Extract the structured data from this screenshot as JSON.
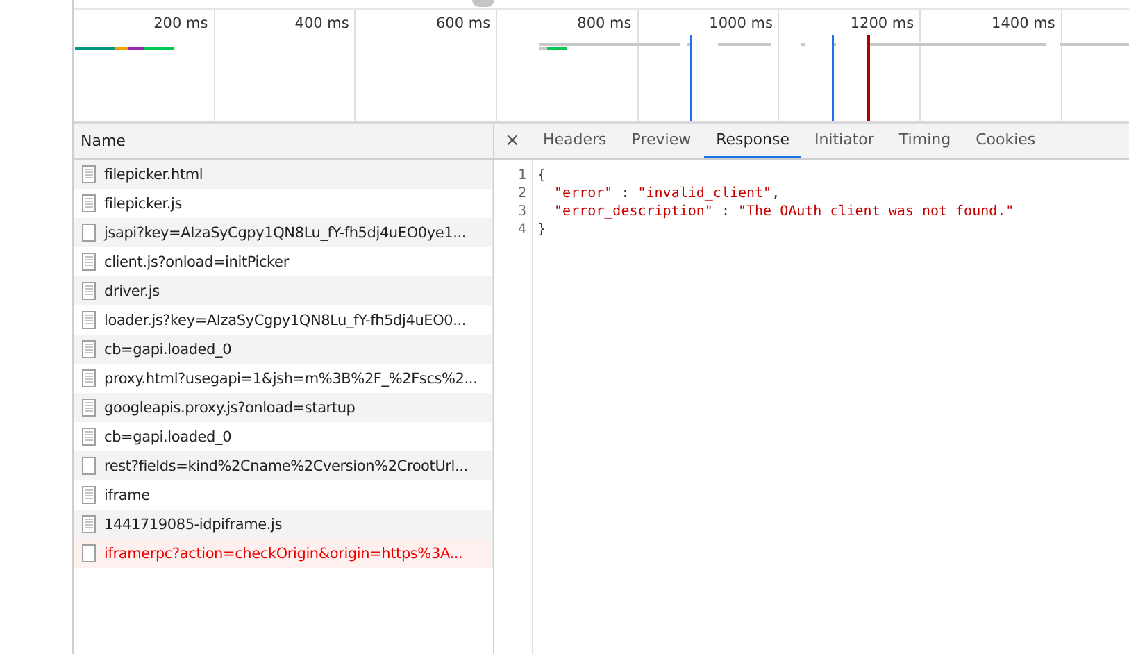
{
  "overview": {
    "ticks": [
      "200 ms",
      "400 ms",
      "600 ms",
      "800 ms",
      "1000 ms",
      "1200 ms",
      "1400 ms"
    ]
  },
  "requests": {
    "column": "Name",
    "rows": [
      {
        "name": "filepicker.html",
        "kind": "document",
        "failed": false
      },
      {
        "name": "filepicker.js",
        "kind": "document",
        "failed": false
      },
      {
        "name": "jsapi?key=AIzaSyCgpy1QN8Lu_fY-fh5dj4uEO0ye1...",
        "kind": "blank",
        "failed": false
      },
      {
        "name": "client.js?onload=initPicker",
        "kind": "document",
        "failed": false
      },
      {
        "name": "driver.js",
        "kind": "document",
        "failed": false
      },
      {
        "name": "loader.js?key=AIzaSyCgpy1QN8Lu_fY-fh5dj4uEO0...",
        "kind": "document",
        "failed": false
      },
      {
        "name": "cb=gapi.loaded_0",
        "kind": "document",
        "failed": false
      },
      {
        "name": "proxy.html?usegapi=1&jsh=m%3B%2F_%2Fscs%2...",
        "kind": "document",
        "failed": false
      },
      {
        "name": "googleapis.proxy.js?onload=startup",
        "kind": "document",
        "failed": false
      },
      {
        "name": "cb=gapi.loaded_0",
        "kind": "document",
        "failed": false
      },
      {
        "name": "rest?fields=kind%2Cname%2Cversion%2CrootUrl...",
        "kind": "blank",
        "failed": false
      },
      {
        "name": "iframe",
        "kind": "document",
        "failed": false
      },
      {
        "name": "1441719085-idpiframe.js",
        "kind": "document",
        "failed": false
      },
      {
        "name": "iframerpc?action=checkOrigin&origin=https%3A...",
        "kind": "blank",
        "failed": true
      }
    ]
  },
  "detail": {
    "close": "×",
    "tabs": [
      {
        "label": "Headers",
        "selected": false
      },
      {
        "label": "Preview",
        "selected": false
      },
      {
        "label": "Response",
        "selected": true
      },
      {
        "label": "Initiator",
        "selected": false
      },
      {
        "label": "Timing",
        "selected": false
      },
      {
        "label": "Cookies",
        "selected": false
      }
    ],
    "lines": [
      {
        "number": "1",
        "parts": [
          {
            "text": "{",
            "kind": "punct"
          }
        ]
      },
      {
        "number": "2",
        "parts": [
          {
            "text": "  \"error\"",
            "kind": "string"
          },
          {
            "text": " : ",
            "kind": "punct"
          },
          {
            "text": "\"invalid_client\"",
            "kind": "string"
          },
          {
            "text": ",",
            "kind": "punct"
          }
        ]
      },
      {
        "number": "3",
        "parts": [
          {
            "text": "  \"error_description\"",
            "kind": "string"
          },
          {
            "text": " : ",
            "kind": "punct"
          },
          {
            "text": "\"The OAuth client was not found.\"",
            "kind": "string"
          }
        ]
      },
      {
        "number": "4",
        "parts": [
          {
            "text": "}",
            "kind": "punct"
          }
        ]
      }
    ]
  }
}
